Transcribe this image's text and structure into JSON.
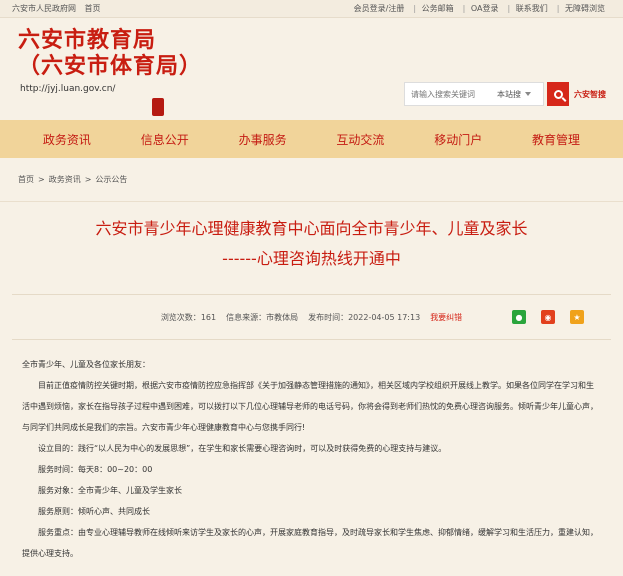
{
  "topbar": {
    "left": [
      "六安市人民政府网",
      "首页"
    ],
    "right": [
      "会员登录/注册",
      "公务邮箱",
      "OA登录",
      "联系我们",
      "无障碍浏览"
    ]
  },
  "header": {
    "title_line1": "六安市教育局",
    "title_line2": "（六安市体育局）",
    "url": "http://jyj.luan.gov.cn/",
    "search_placeholder": "请输入搜索关键词",
    "search_scope": "本站搜",
    "smart_link": "六安智搜"
  },
  "nav": [
    "政务资讯",
    "信息公开",
    "办事服务",
    "互动交流",
    "移动门户",
    "教育管理"
  ],
  "breadcrumb": [
    "首页",
    "政务资讯",
    "公示公告"
  ],
  "article": {
    "title_line1": "六安市青少年心理健康教育中心面向全市青少年、儿童及家长",
    "title_line2": "------心理咨询热线开通中",
    "meta": {
      "views_label": "浏览次数：",
      "views": "161",
      "source_label": "信息来源：",
      "source": "市教体局",
      "date_label": "发布时间：",
      "date": "2022-04-05 17:13",
      "error_link": "我要纠错"
    },
    "paragraphs": [
      "全市青少年、儿童及各位家长朋友：",
      "目前正值疫情防控关键时期，根据六安市疫情防控应急指挥部《关于加强静态管理措施的通知》，相关区域内学校组织开展线上教学。如果各位同学在学习和生活中遇到烦恼，家长在指导孩子过程中遇到困难，可以拨打以下几位心理辅导老师的电话号码，你将会得到老师们热忱的免费心理咨询服务。倾听青少年儿童心声，与同学们共同成长是我们的宗旨。六安市青少年心理健康教育中心与您携手同行!",
      "设立目的：践行“以人民为中心的发展思想”，在学生和家长需要心理咨询时，可以及时获得免费的心理支持与建议。",
      "服务时间：每天8：00~20：00",
      "服务对象：全市青少年、儿童及学生家长",
      "服务原则：倾听心声、共同成长",
      "服务重点：由专业心理辅导教师在线倾听来访学生及家长的心声，开展家庭教育指导，及时疏导家长和学生焦虑、抑郁情绪，缓解学习和生活压力，重建认知，提供心理支持。"
    ]
  },
  "share_icons": [
    "wechat-icon",
    "weibo-icon",
    "favorite-icon"
  ]
}
